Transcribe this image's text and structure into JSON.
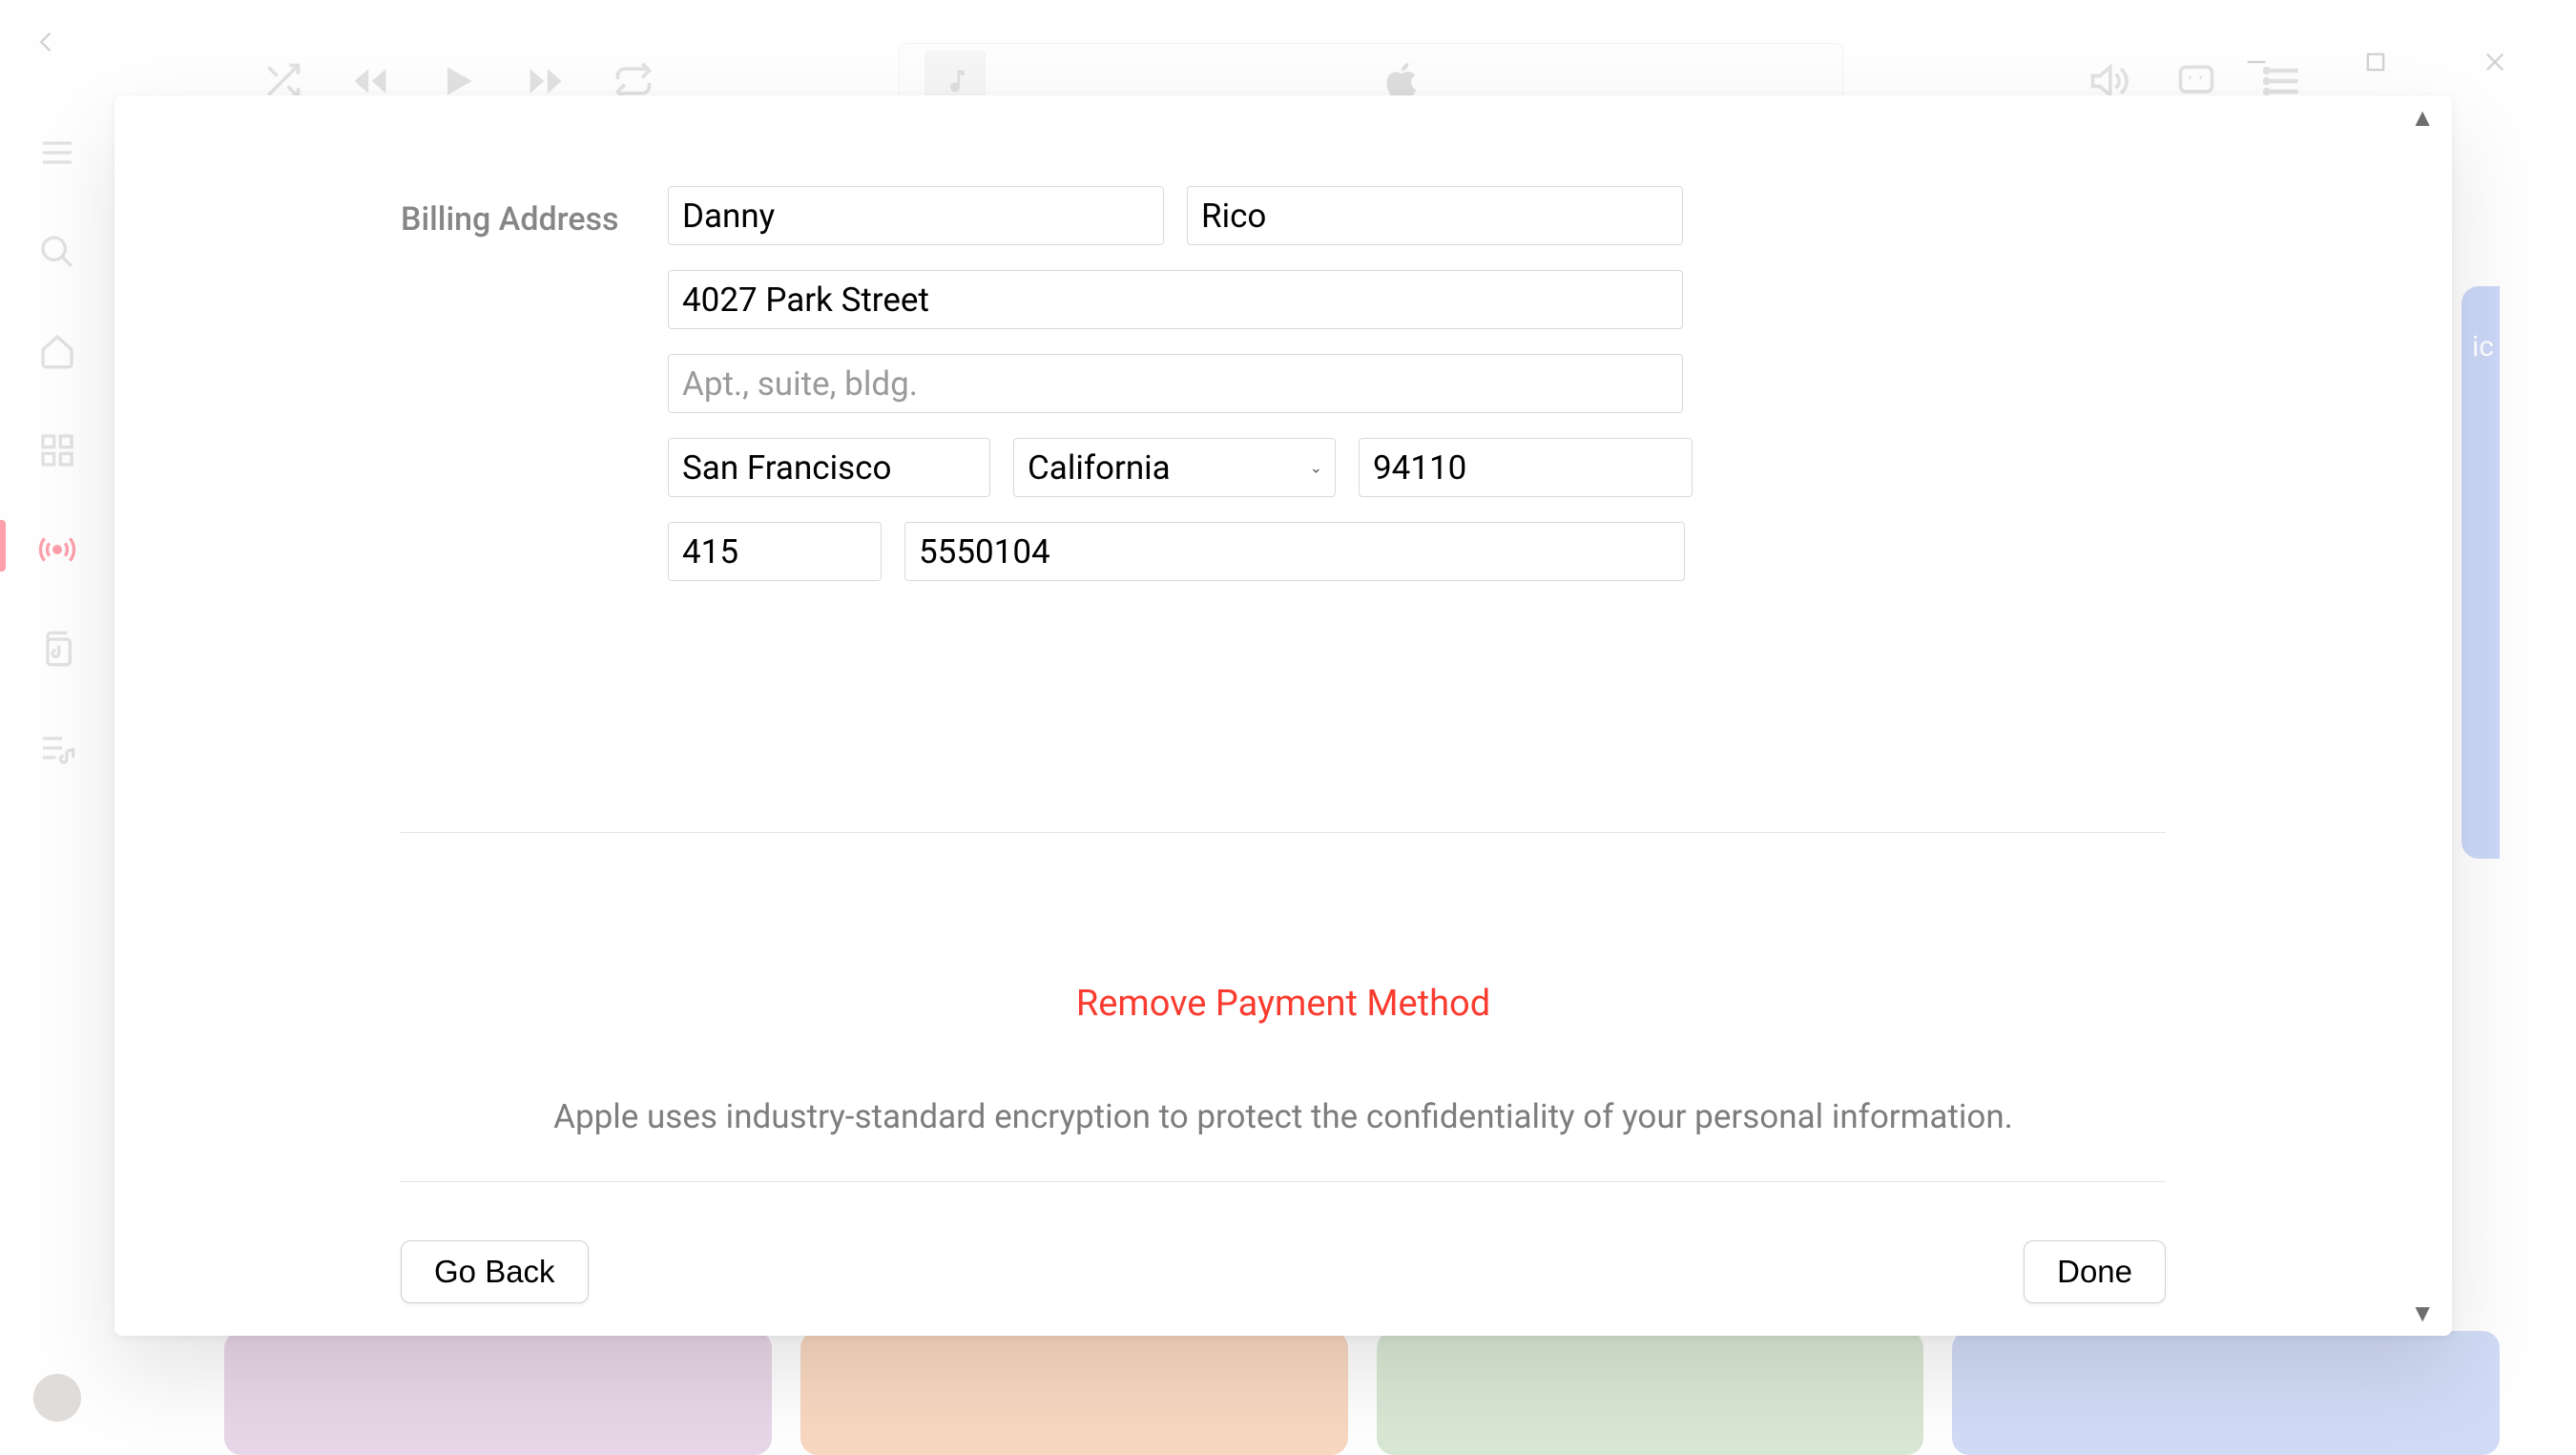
{
  "form": {
    "section_label": "Billing Address",
    "first_name": "Danny",
    "last_name": "Rico",
    "street": "4027 Park Street",
    "apt_placeholder": "Apt., suite, bldg.",
    "apt": "",
    "city": "San Francisco",
    "state": "California",
    "zip": "94110",
    "phone_area": "415",
    "phone_number": "5550104"
  },
  "actions": {
    "remove_label": "Remove Payment Method",
    "info_text": "Apple uses industry-standard encryption to protect the confidentiality of your personal information.",
    "go_back": "Go Back",
    "done": "Done"
  },
  "bg": {
    "card_text": "ic"
  }
}
